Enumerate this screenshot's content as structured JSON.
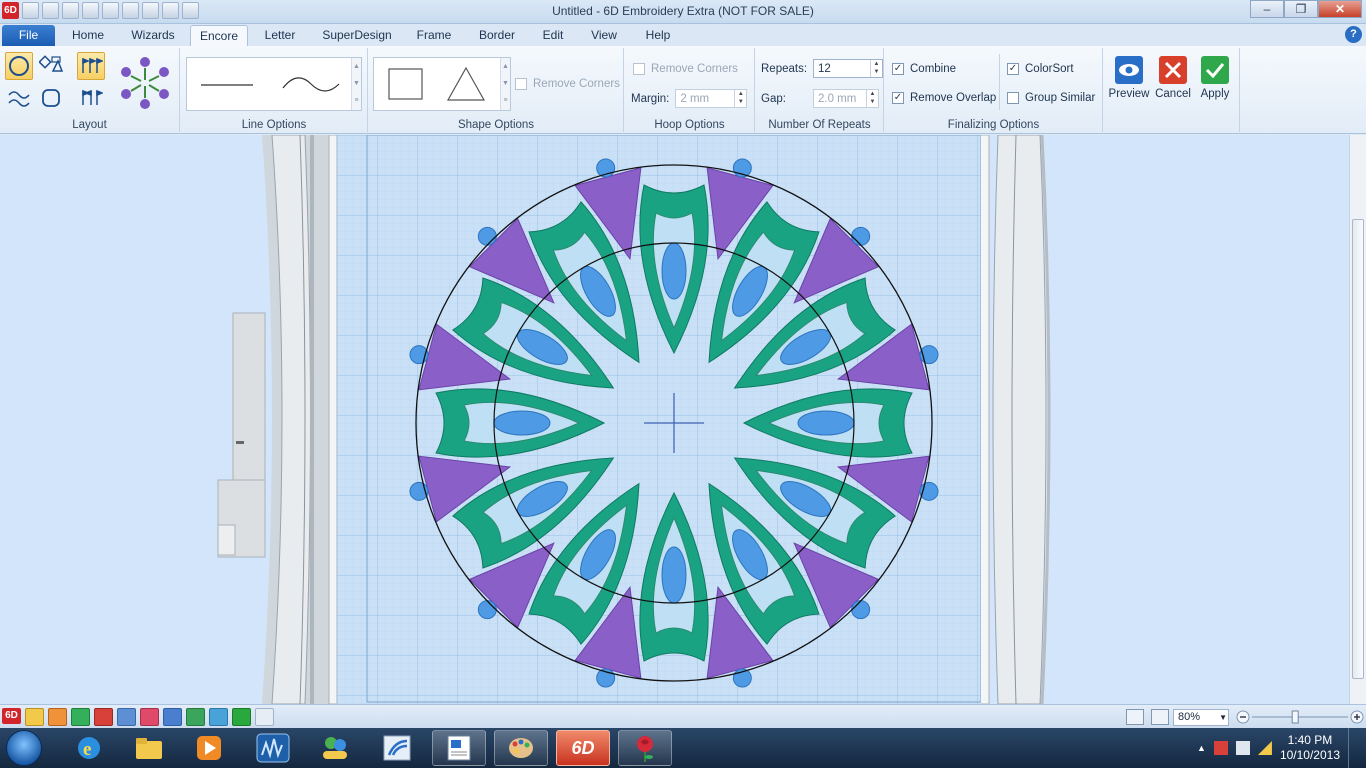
{
  "window": {
    "title": "Untitled - 6D Embroidery Extra (NOT FOR SALE)",
    "app_badge": "6D",
    "minimize": "–",
    "restore": "❐",
    "close": "✕"
  },
  "tabs": {
    "file": "File",
    "home": "Home",
    "wizards": "Wizards",
    "encore": "Encore",
    "letter": "Letter",
    "superdesign": "SuperDesign",
    "frame": "Frame",
    "border": "Border",
    "edit": "Edit",
    "view": "View",
    "help": "Help",
    "help_icon": "?"
  },
  "ribbon": {
    "layout_label": "Layout",
    "line_options_label": "Line Options",
    "shape_options_label": "Shape Options",
    "hoop_options_label": "Hoop Options",
    "repeats_group_label": "Number Of Repeats",
    "finalizing_label": "Finalizing Options",
    "remove_corners": "Remove Corners",
    "remove_corners_checked": false,
    "hoop_remove_corners": "Remove Corners",
    "margin_label": "Margin:",
    "margin_value": "2 mm",
    "repeats_label": "Repeats:",
    "repeats_value": "12",
    "gap_label": "Gap:",
    "gap_value": "2.0 mm",
    "combine": "Combine",
    "remove_overlap": "Remove Overlap",
    "colorsort": "ColorSort",
    "group_similar": "Group Similar",
    "combine_checked": true,
    "remove_overlap_checked": true,
    "colorsort_checked": true,
    "group_similar_checked": false,
    "preview": "Preview",
    "cancel": "Cancel",
    "apply": "Apply"
  },
  "canvas": {
    "repeats": 12,
    "colors": {
      "purple": "#8a5fc8",
      "teal": "#1aa383",
      "blue": "#4e9ae4",
      "grid_bg": "#c9e0f6",
      "outline": "#111111"
    }
  },
  "statusbar": {
    "zoom": "80%",
    "zoom_fraction": 0.45
  },
  "taskbar": {
    "time": "1:40 PM",
    "date": "10/10/2013",
    "app_badge": "6D"
  }
}
